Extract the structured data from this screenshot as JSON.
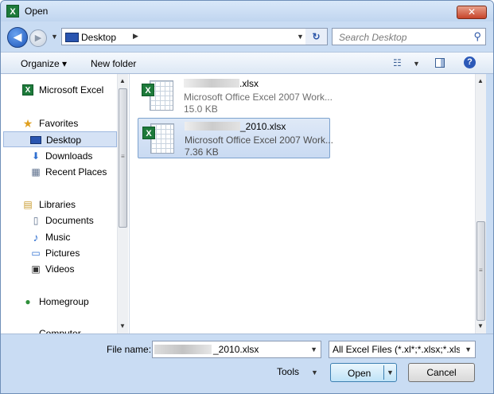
{
  "window": {
    "title": "Open",
    "close_glyph": "✕",
    "title_icon": "X"
  },
  "nav": {
    "back_glyph": "◀",
    "forward_glyph": "▶",
    "history_dropdown": "▼",
    "address": "Desktop",
    "address_sep": "▶",
    "address_dropdown": "▼",
    "refresh_glyph": "↻",
    "search_placeholder": "Search Desktop",
    "search_glyph": "⚲"
  },
  "toolbar": {
    "organize": "Organize ▾",
    "new_folder": "New folder",
    "view_glyph": "☷",
    "view_dropdown": "▼",
    "help_glyph": "?"
  },
  "sidebar": {
    "items": [
      {
        "label": "Microsoft Excel",
        "icon": "excel-icon",
        "glyph": "X"
      },
      {
        "label": "Favorites",
        "icon": "star-icon",
        "glyph": "★"
      },
      {
        "label": "Desktop",
        "icon": "desktop-icon",
        "glyph": ""
      },
      {
        "label": "Downloads",
        "icon": "downloads-icon",
        "glyph": "⬇"
      },
      {
        "label": "Recent Places",
        "icon": "recent-places-icon",
        "glyph": "▦"
      },
      {
        "label": "Libraries",
        "icon": "libraries-icon",
        "glyph": "▤"
      },
      {
        "label": "Documents",
        "icon": "documents-icon",
        "glyph": "▯"
      },
      {
        "label": "Music",
        "icon": "music-icon",
        "glyph": "♪"
      },
      {
        "label": "Pictures",
        "icon": "pictures-icon",
        "glyph": "▭"
      },
      {
        "label": "Videos",
        "icon": "videos-icon",
        "glyph": "▣"
      },
      {
        "label": "Homegroup",
        "icon": "homegroup-icon",
        "glyph": "●"
      },
      {
        "label": "Computer",
        "icon": "computer-icon",
        "glyph": "▬"
      }
    ],
    "scroll_up": "▲",
    "scroll_down": "▼",
    "scroll_grip": "≡"
  },
  "files": [
    {
      "name_suffix": ".xlsx",
      "type": "Microsoft Office Excel 2007 Work...",
      "size": "15.0 KB",
      "selected": false
    },
    {
      "name_suffix": "_2010.xlsx",
      "type": "Microsoft Office Excel 2007 Work...",
      "size": "7.36 KB",
      "selected": true
    }
  ],
  "file_badge": "X",
  "filepane_scroll": {
    "up": "▲",
    "down": "▼",
    "grip": "≡"
  },
  "footer": {
    "filename_label": "File name:",
    "filename_value": "_2010.xlsx",
    "filename_dropdown": "▼",
    "filetype_value": "All Excel Files (*.xl*;*.xlsx;*.xlsm;",
    "filetype_dropdown": "▼",
    "tools_label": "Tools",
    "tools_dropdown": "▼",
    "open_label": "Open",
    "open_dropdown": "▼",
    "cancel_label": "Cancel"
  }
}
